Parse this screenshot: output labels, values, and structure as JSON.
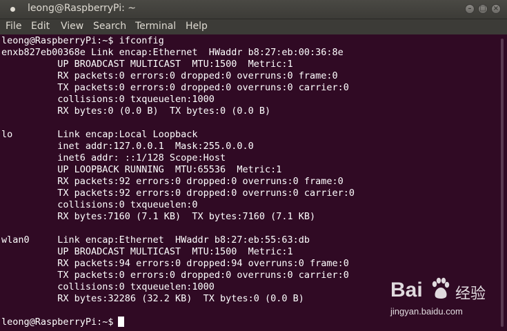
{
  "window": {
    "title": "leong@RaspberryPi: ~",
    "buttons": {
      "minimize": "–",
      "maximize": "□",
      "close": "×"
    }
  },
  "menu": {
    "items": [
      "File",
      "Edit",
      "View",
      "Search",
      "Terminal",
      "Help"
    ]
  },
  "terminal": {
    "lines": [
      "leong@RaspberryPi:~$ ifconfig",
      "enxb827eb00368e Link encap:Ethernet  HWaddr b8:27:eb:00:36:8e",
      "          UP BROADCAST MULTICAST  MTU:1500  Metric:1",
      "          RX packets:0 errors:0 dropped:0 overruns:0 frame:0",
      "          TX packets:0 errors:0 dropped:0 overruns:0 carrier:0",
      "          collisions:0 txqueuelen:1000",
      "          RX bytes:0 (0.0 B)  TX bytes:0 (0.0 B)",
      "",
      "lo        Link encap:Local Loopback",
      "          inet addr:127.0.0.1  Mask:255.0.0.0",
      "          inet6 addr: ::1/128 Scope:Host",
      "          UP LOOPBACK RUNNING  MTU:65536  Metric:1",
      "          RX packets:92 errors:0 dropped:0 overruns:0 frame:0",
      "          TX packets:92 errors:0 dropped:0 overruns:0 carrier:0",
      "          collisions:0 txqueuelen:0",
      "          RX bytes:7160 (7.1 KB)  TX bytes:7160 (7.1 KB)",
      "",
      "wlan0     Link encap:Ethernet  HWaddr b8:27:eb:55:63:db",
      "          UP BROADCAST MULTICAST  MTU:1500  Metric:1",
      "          RX packets:94 errors:0 dropped:94 overruns:0 frame:0",
      "          TX packets:0 errors:0 dropped:0 overruns:0 carrier:0",
      "          collisions:0 txqueuelen:1000",
      "          RX bytes:32286 (32.2 KB)  TX bytes:0 (0.0 B)",
      "",
      "leong@RaspberryPi:~$"
    ]
  },
  "watermark": {
    "logo": "Bai",
    "logo_suffix": "经验",
    "url": "jingyan.baidu.com"
  },
  "colors": {
    "terminal_bg": "#300a24",
    "terminal_fg": "#ffffff",
    "titlebar_bg": "#3c3b37",
    "title_fg": "#dfdbd2"
  }
}
